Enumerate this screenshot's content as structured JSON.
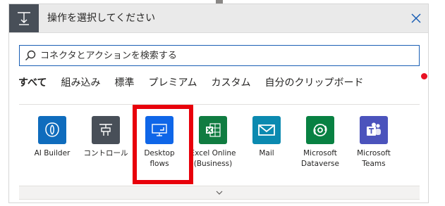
{
  "header": {
    "title": "操作を選択してください",
    "icon": "flow-step-icon",
    "close_icon": "close-icon"
  },
  "search": {
    "placeholder": "コネクタとアクションを検索する",
    "value": ""
  },
  "tabs": [
    {
      "label": "すべて",
      "active": true
    },
    {
      "label": "組み込み",
      "active": false
    },
    {
      "label": "標準",
      "active": false
    },
    {
      "label": "プレミアム",
      "active": false
    },
    {
      "label": "カスタム",
      "active": false
    },
    {
      "label": "自分のクリップボード",
      "active": false
    }
  ],
  "connectors": [
    {
      "label": "AI Builder",
      "icon": "ai-builder-icon",
      "color": "#0f6cbd"
    },
    {
      "label": "コントロール",
      "icon": "control-icon",
      "color": "#484f58"
    },
    {
      "label": "Desktop flows",
      "icon": "desktop-flows-icon",
      "color": "#0f66e8"
    },
    {
      "label": "Excel Online (Business)",
      "icon": "excel-icon",
      "color": "#107c41"
    },
    {
      "label": "Mail",
      "icon": "mail-icon",
      "color": "#0b8ab0"
    },
    {
      "label": "Microsoft Dataverse",
      "icon": "dataverse-icon",
      "color": "#088142"
    },
    {
      "label": "Microsoft Teams",
      "icon": "teams-icon",
      "color": "#4b53bc"
    }
  ],
  "colors": {
    "highlight": "#e8000b",
    "accent": "#1a5fb4",
    "notification_dot": "#e81123"
  }
}
